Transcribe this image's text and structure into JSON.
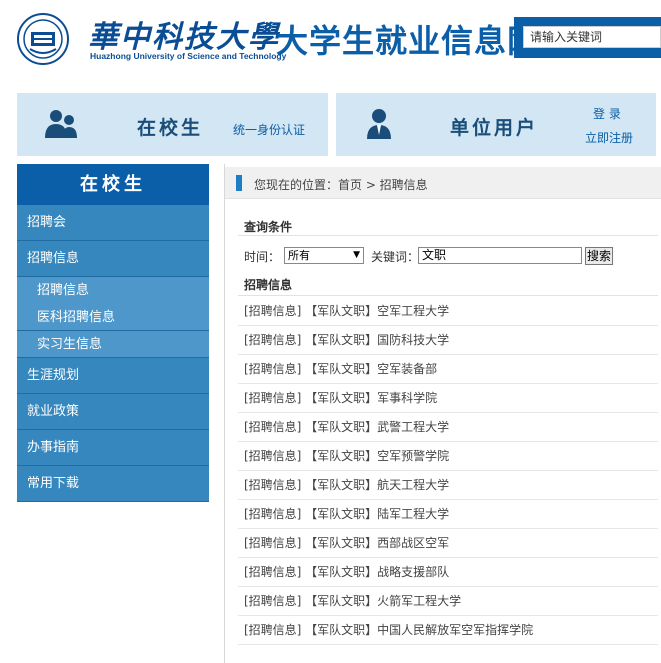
{
  "header": {
    "logo_cn": "華中科技大學",
    "logo_en": "Huazhong University of Science and Technology",
    "site_title": "大学生就业信息网",
    "search_placeholder": "请输入关键词"
  },
  "panels": {
    "student": {
      "title": "在校生",
      "link": "统一身份认证"
    },
    "company": {
      "title": "单位用户",
      "login": "登 录",
      "register": "立即注册"
    }
  },
  "sidebar": {
    "heading": "在校生",
    "items": [
      {
        "label": "招聘会"
      },
      {
        "label": "招聘信息",
        "children": [
          "招聘信息",
          "医科招聘信息",
          "实习生信息"
        ]
      },
      {
        "label": "生涯规划"
      },
      {
        "label": "就业政策"
      },
      {
        "label": "办事指南"
      },
      {
        "label": "常用下载"
      }
    ]
  },
  "breadcrumb": "您现在的位置：首页 > 招聘信息",
  "query": {
    "title": "查询条件",
    "time_label": "时间：",
    "time_value": "所有",
    "keyword_label": "关键词：",
    "keyword_value": "文职",
    "search_button": "搜索"
  },
  "list": {
    "title": "招聘信息",
    "items": [
      "[招聘信息] 【军队文职】空军工程大学",
      "[招聘信息] 【军队文职】国防科技大学",
      "[招聘信息] 【军队文职】空军装备部",
      "[招聘信息] 【军队文职】军事科学院",
      "[招聘信息] 【军队文职】武警工程大学",
      "[招聘信息] 【军队文职】空军预警学院",
      "[招聘信息] 【军队文职】航天工程大学",
      "[招聘信息] 【军队文职】陆军工程大学",
      "[招聘信息] 【军队文职】西部战区空军",
      "[招聘信息] 【军队文职】战略支援部队",
      "[招聘信息] 【军队文职】火箭军工程大学",
      "[招聘信息] 【军队文职】中国人民解放军空军指挥学院"
    ]
  },
  "colors": {
    "brand_blue": "#0b5ea8",
    "sidebar_item": "#3687be",
    "sidebar_sub": "#4d97ca",
    "panel_bg": "#d2e6f3"
  }
}
